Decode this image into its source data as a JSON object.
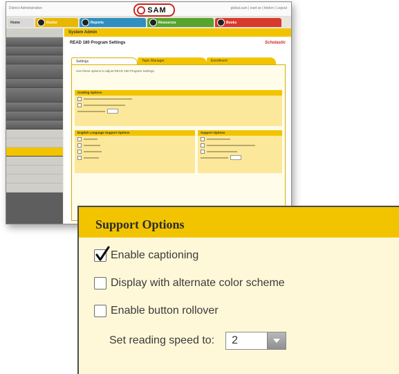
{
  "app": {
    "topbar_left": "District Administration",
    "logo": "SAM",
    "topbar_right": "global.sum | eset se | feldon | Logout",
    "tabs": {
      "home": "Home",
      "roster": "Roster",
      "reports": "Reports",
      "resources": "Resources",
      "books": "Books"
    },
    "main_header": "System Admin",
    "main_title": "READ 180 Program Settings",
    "brand": "Scholastic",
    "inner_tabs": [
      "Settings",
      "Topic Manager",
      "Enrollment"
    ],
    "panel_hint": "Use these options to adjust READ 180 Program Settings.",
    "section_1_title": "Grading Options",
    "section_2_title": "English Language Support Options",
    "section_3_title": "Support Options"
  },
  "callout": {
    "title": "Support Options",
    "options": [
      {
        "label": "Enable captioning",
        "checked": true
      },
      {
        "label": "Display with alternate color scheme",
        "checked": false
      },
      {
        "label": "Enable button rollover",
        "checked": false
      }
    ],
    "reading_speed_label": "Set reading speed to:",
    "reading_speed_value": "2"
  },
  "colors": {
    "accent_yellow": "#f2c400",
    "panel_cream": "#fff8d8",
    "brand_red": "#c9261e"
  }
}
